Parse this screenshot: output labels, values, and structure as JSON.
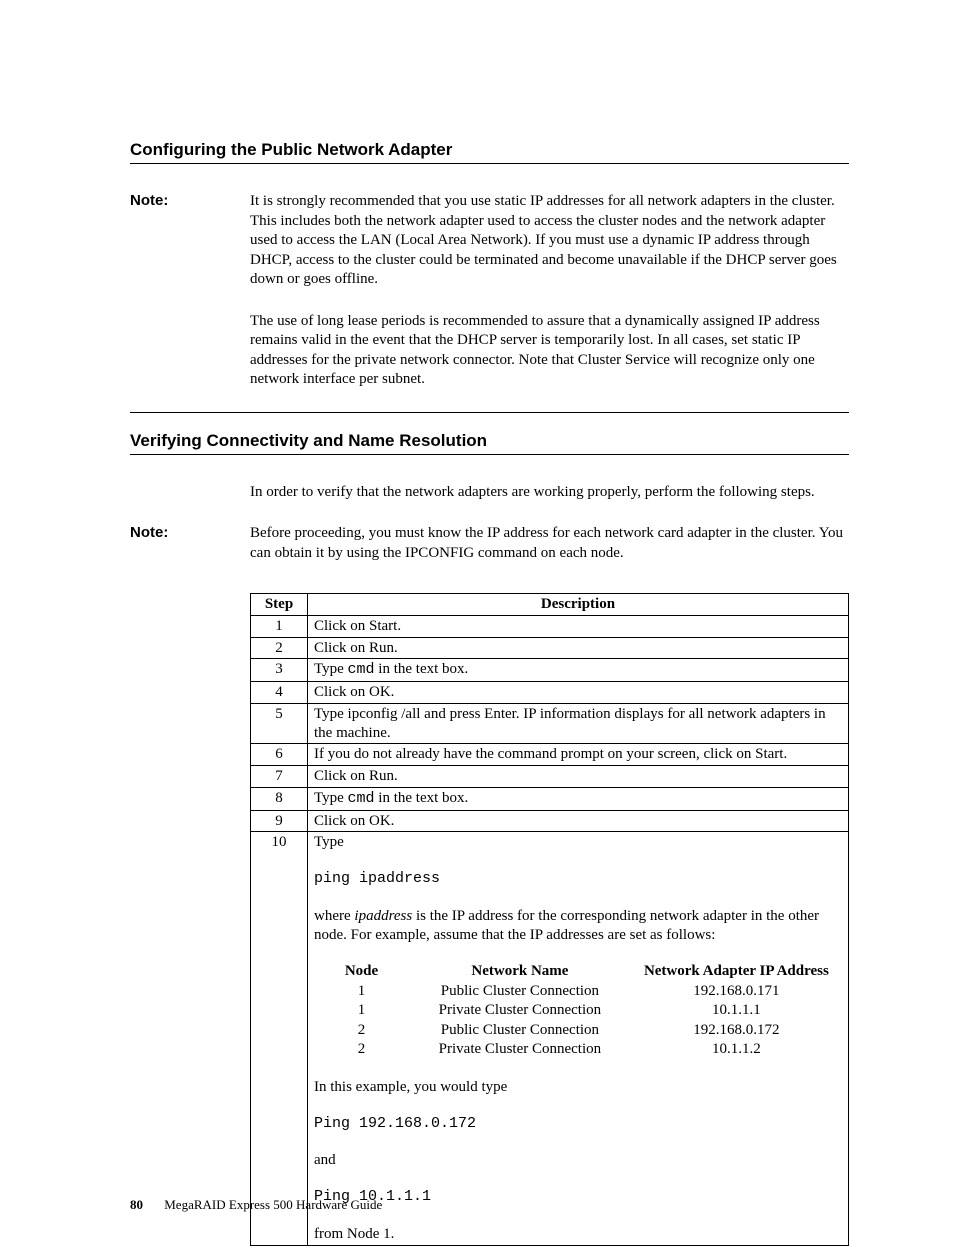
{
  "sections": {
    "heading1": "Configuring the Public Network Adapter",
    "heading2": "Verifying Connectivity and Name Resolution"
  },
  "notes": {
    "label1": "Note:",
    "label2": "Note:",
    "text1a": "It is strongly recommended that you use static IP addresses for all network adapters in the cluster.  This includes both the network adapter used to access the cluster nodes and the network adapter used to access the LAN (Local Area Network).  If you must use a dynamic IP address through DHCP, access to the cluster could be terminated and become unavailable if the DHCP server goes down or goes offline.",
    "text1b": "The use of long lease periods is recommended to assure that a dynamically assigned IP address remains valid in the event that the DHCP server is temporarily lost. In all cases, set static IP addresses for the private network connector. Note that Cluster Service will recognize only one network interface per subnet.",
    "intro2": "In order to verify that the network adapters are working properly, perform the following steps.",
    "text2": "Before proceeding, you must know the IP address for each network card adapter in the cluster.  You can obtain it by using the IPCONFIG command on each node."
  },
  "table": {
    "head_step": "Step",
    "head_desc": "Description",
    "rows": [
      {
        "n": "1",
        "d": "Click on Start."
      },
      {
        "n": "2",
        "d": "Click on Run."
      },
      {
        "n": "3",
        "d_pre": "Type ",
        "d_mono": "cmd",
        "d_post": " in the text box."
      },
      {
        "n": "4",
        "d": "Click on OK."
      },
      {
        "n": "5",
        "d": "Type ipconfig /all and press Enter. IP information displays for all network adapters in the machine."
      },
      {
        "n": "6",
        "d": "If you do not already have the command prompt on your screen, click on Start."
      },
      {
        "n": "7",
        "d": "Click on Run."
      },
      {
        "n": "8",
        "d_pre": "Type ",
        "d_mono": "cmd",
        "d_post": " in the text box."
      },
      {
        "n": "9",
        "d": "Click on OK."
      }
    ],
    "row10": {
      "n": "10",
      "type_word": "Type",
      "ping_cmd": "ping ipaddress",
      "where_pre": "where ",
      "where_it": "ipaddress",
      "where_post": " is the IP address for the corresponding network adapter in the other node. For example, assume that the IP addresses are set as follows:",
      "inner_head": {
        "c1": "Node",
        "c2": "Network Name",
        "c3": "Network Adapter IP Address"
      },
      "inner_rows": [
        {
          "c1": "1",
          "c2": "Public Cluster Connection",
          "c3": "192.168.0.171"
        },
        {
          "c1": "1",
          "c2": "Private Cluster Connection",
          "c3": "10.1.1.1"
        },
        {
          "c1": "2",
          "c2": "Public Cluster Connection",
          "c3": "192.168.0.172"
        },
        {
          "c1": "2",
          "c2": "Private Cluster Connection",
          "c3": "10.1.1.2"
        }
      ],
      "example_line": "In this example, you would type",
      "ping1": "Ping 192.168.0.172",
      "and_word": "and",
      "ping2": "Ping 10.1.1.1",
      "from_line": "from Node 1."
    }
  },
  "footer": {
    "page": "80",
    "title": "MegaRAID Express 500 Hardware Guide"
  }
}
